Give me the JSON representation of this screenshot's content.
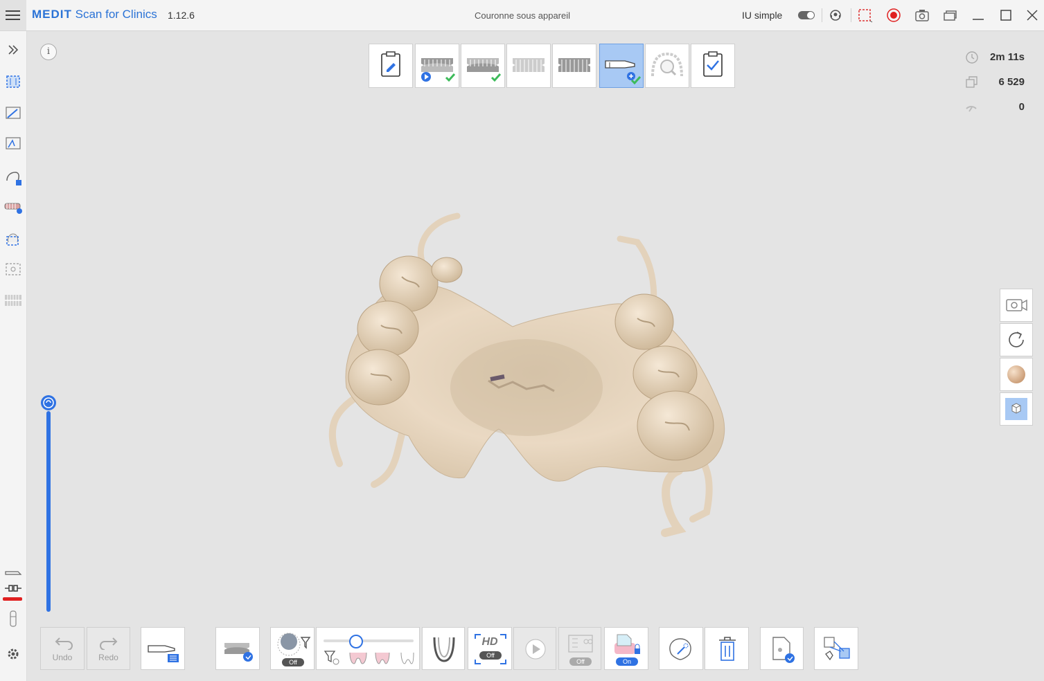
{
  "app": {
    "brand": "MEDIT",
    "name": "Scan for Clinics",
    "version": "1.12.6",
    "document_title": "Couronne sous appareil",
    "simple_ui_label": "IU simple",
    "simple_ui_enabled": true
  },
  "stats": {
    "elapsed_time": "2m 11s",
    "frame_count": "6 529",
    "third_value": "0"
  },
  "toolbar_bottom": {
    "undo_label": "Undo",
    "redo_label": "Redo",
    "hd_text": "HD",
    "hd_state": "Off",
    "filter_state": "Off",
    "disabled_tool_state": "Off",
    "lock_state": "On"
  },
  "colors": {
    "accent": "#2f72e3",
    "record": "#e02020",
    "active_stage": "#a8c9f4",
    "model": "#e8d9c4",
    "check": "#3dbb5a"
  }
}
